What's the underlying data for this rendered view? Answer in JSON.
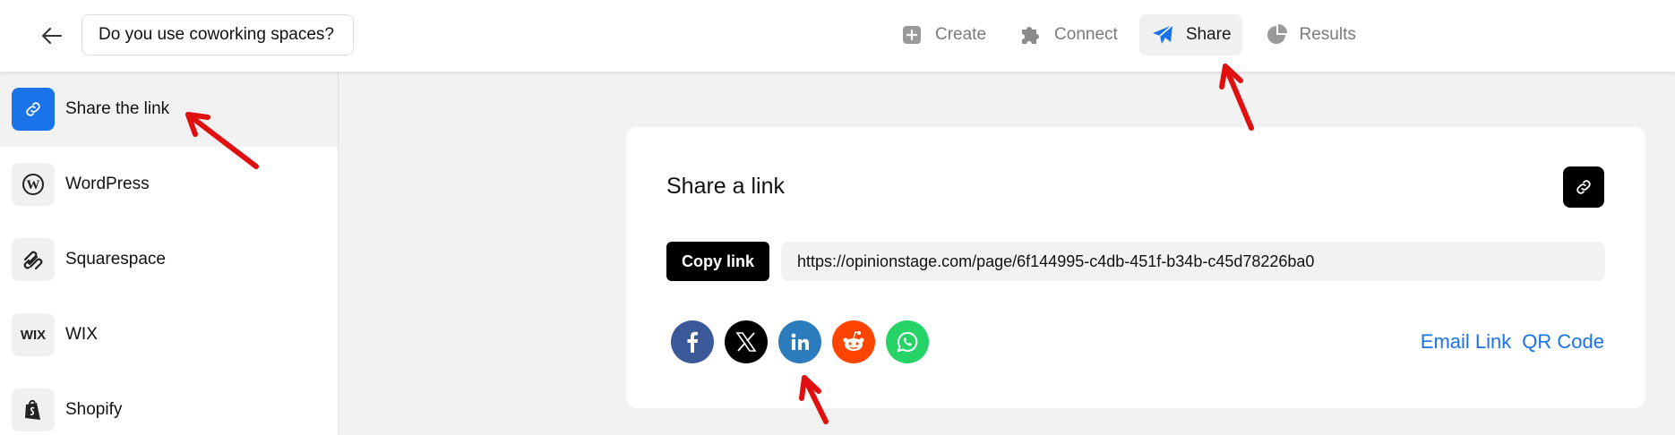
{
  "header": {
    "title": "Do you use coworking spaces?",
    "nav": [
      {
        "label": "Create",
        "icon": "plus-square-icon",
        "active": false
      },
      {
        "label": "Connect",
        "icon": "puzzle-icon",
        "active": false
      },
      {
        "label": "Share",
        "icon": "send-icon",
        "active": true
      },
      {
        "label": "Results",
        "icon": "pie-chart-icon",
        "active": false
      }
    ]
  },
  "sidebar": {
    "items": [
      {
        "label": "Share the link",
        "icon": "link-icon",
        "active": true
      },
      {
        "label": "WordPress",
        "icon": "wordpress-icon"
      },
      {
        "label": "Squarespace",
        "icon": "squarespace-icon"
      },
      {
        "label": "WIX",
        "icon": "wix-icon",
        "icon_text": "WIX"
      },
      {
        "label": "Shopify",
        "icon": "shopify-icon"
      }
    ]
  },
  "card": {
    "title": "Share a link",
    "copy_label": "Copy link",
    "url": "https://opinionstage.com/page/6f144995-c4db-451f-b34b-c45d78226ba0",
    "socials": [
      {
        "name": "facebook-icon",
        "color": "#3b5998"
      },
      {
        "name": "x-icon",
        "color": "#000000"
      },
      {
        "name": "linkedin-icon",
        "color": "#2b7bbd"
      },
      {
        "name": "reddit-icon",
        "color": "#ff4500"
      },
      {
        "name": "whatsapp-icon",
        "color": "#25d366"
      }
    ],
    "email_link": "Email Link",
    "qr_code": "QR Code"
  },
  "colors": {
    "accent": "#1a73e8",
    "annotation": "#e01010"
  }
}
